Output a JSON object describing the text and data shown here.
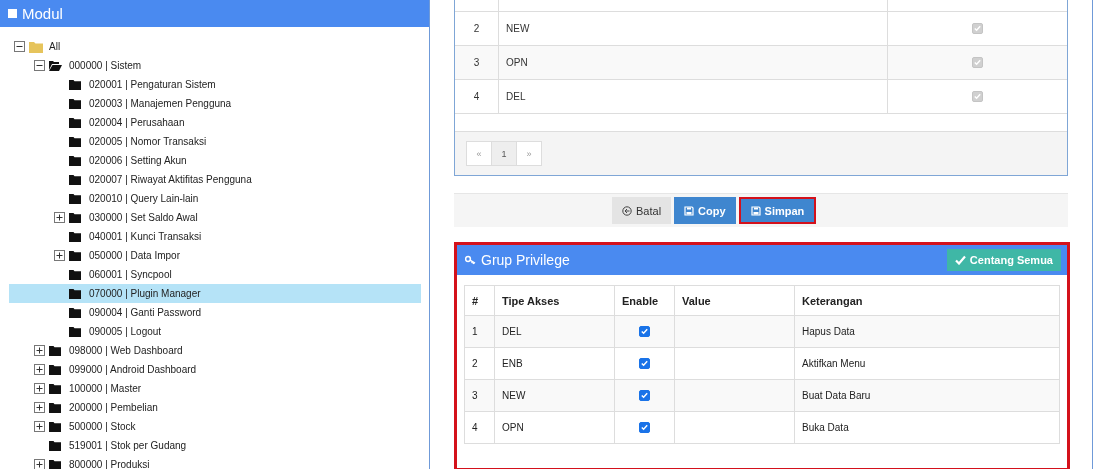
{
  "module_panel": {
    "title": "Modul",
    "tree": [
      {
        "label": "All",
        "kind": "root",
        "expanded": true,
        "selected": false,
        "children": [
          {
            "label": "000000 | Sistem",
            "kind": "branch",
            "expanded": true,
            "selected": false,
            "children": [
              {
                "label": "020001 | Pengaturan Sistem",
                "kind": "leaf",
                "selected": false
              },
              {
                "label": "020003 | Manajemen Pengguna",
                "kind": "leaf",
                "selected": false
              },
              {
                "label": "020004 | Perusahaan",
                "kind": "leaf",
                "selected": false
              },
              {
                "label": "020005 | Nomor Transaksi",
                "kind": "leaf",
                "selected": false
              },
              {
                "label": "020006 | Setting Akun",
                "kind": "leaf",
                "selected": false
              },
              {
                "label": "020007 | Riwayat Aktifitas Pengguna",
                "kind": "leaf",
                "selected": false
              },
              {
                "label": "020010 | Query Lain-lain",
                "kind": "leaf",
                "selected": false
              },
              {
                "label": "030000 | Set Saldo Awal",
                "kind": "branch",
                "expanded": false,
                "selected": false
              },
              {
                "label": "040001 | Kunci Transaksi",
                "kind": "leaf",
                "selected": false
              },
              {
                "label": "050000 | Data Impor",
                "kind": "branch",
                "expanded": false,
                "selected": false
              },
              {
                "label": "060001 | Syncpool",
                "kind": "leaf",
                "selected": false
              },
              {
                "label": "070000 | Plugin Manager",
                "kind": "leaf",
                "selected": true
              },
              {
                "label": "090004 | Ganti Password",
                "kind": "leaf",
                "selected": false
              },
              {
                "label": "090005 | Logout",
                "kind": "leaf",
                "selected": false
              }
            ]
          },
          {
            "label": "098000 | Web Dashboard",
            "kind": "branch",
            "expanded": false,
            "selected": false
          },
          {
            "label": "099000 | Android Dashboard",
            "kind": "branch",
            "expanded": false,
            "selected": false
          },
          {
            "label": "100000 | Master",
            "kind": "branch",
            "expanded": false,
            "selected": false
          },
          {
            "label": "200000 | Pembelian",
            "kind": "branch",
            "expanded": false,
            "selected": false
          },
          {
            "label": "500000 | Stock",
            "kind": "branch",
            "expanded": false,
            "selected": false
          },
          {
            "label": "519001 | Stok per Gudang",
            "kind": "leaf",
            "selected": false
          },
          {
            "label": "800000 | Produksi",
            "kind": "branch",
            "expanded": false,
            "selected": false
          }
        ]
      }
    ]
  },
  "access_table": {
    "rows": [
      {
        "number": "2",
        "code": "NEW",
        "checked": true,
        "disabled": true
      },
      {
        "number": "3",
        "code": "OPN",
        "checked": true,
        "disabled": true
      },
      {
        "number": "4",
        "code": "DEL",
        "checked": true,
        "disabled": true
      }
    ],
    "pagination": [
      {
        "label": "«",
        "selected": false
      },
      {
        "label": "1",
        "selected": true
      },
      {
        "label": "»",
        "selected": false
      }
    ]
  },
  "actions": [
    {
      "label": "Batal",
      "kind": "default",
      "highlighted": false
    },
    {
      "label": "Copy",
      "kind": "primary",
      "highlighted": false
    },
    {
      "label": "Simpan",
      "kind": "primary",
      "highlighted": true
    }
  ],
  "privilege_panel": {
    "title": "Grup Privilege",
    "check_all_button": "Centang Semua",
    "highlighted": true,
    "columns": [
      "#",
      "Tipe Akses",
      "Enable",
      "Value",
      "Keterangan"
    ],
    "rows": [
      {
        "number": "1",
        "type": "DEL",
        "enabled": true,
        "description": "Hapus Data"
      },
      {
        "number": "2",
        "type": "ENB",
        "enabled": true,
        "description": "Aktifkan Menu"
      },
      {
        "number": "3",
        "type": "NEW",
        "enabled": true,
        "description": "Buat Data Baru"
      },
      {
        "number": "4",
        "type": "OPN",
        "enabled": true,
        "description": "Buka Data"
      }
    ]
  }
}
